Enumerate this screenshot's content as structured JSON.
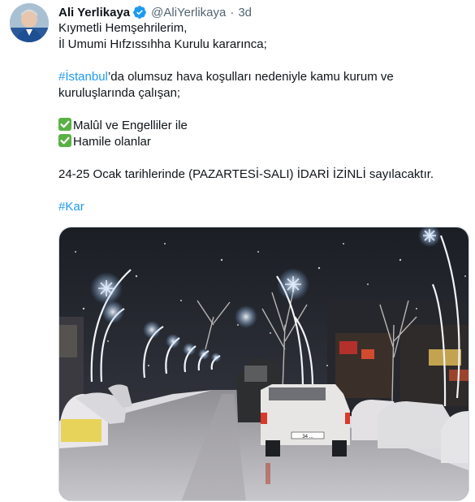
{
  "tweet": {
    "author_name": "Ali Yerlikaya",
    "author_handle": "@AliYerlikaya",
    "separator": "·",
    "time": "3d",
    "lines": {
      "l1": "Kıymetli Hemşehrilerim,",
      "l2": "İl Umumi Hıfzıssıhha Kurulu kararınca;",
      "l3_hashtag": "#İstanbul",
      "l3_rest": "’da olumsuz hava koşulları nedeniyle kamu kurum ve",
      "l4": "kuruluşlarında çalışan;",
      "l5": "Malûl ve Engelliler ile",
      "l6": "Hamile olanlar",
      "l7": "24-25 Ocak tarihlerinde (PAZARTESİ-SALI) İDARİ İZİNLİ sayılacaktır.",
      "l8_hashtag": "#Kar"
    }
  },
  "icons": {
    "verified": "verified-badge-icon",
    "checkmark": "check-mark-icon"
  },
  "colors": {
    "link": "#1d9bf0",
    "secondary_text": "#536471",
    "verified_badge": "#1d9bf0",
    "check_box": "#5ab145"
  },
  "media": {
    "plate_text": "34 ...",
    "description_shown": ""
  }
}
